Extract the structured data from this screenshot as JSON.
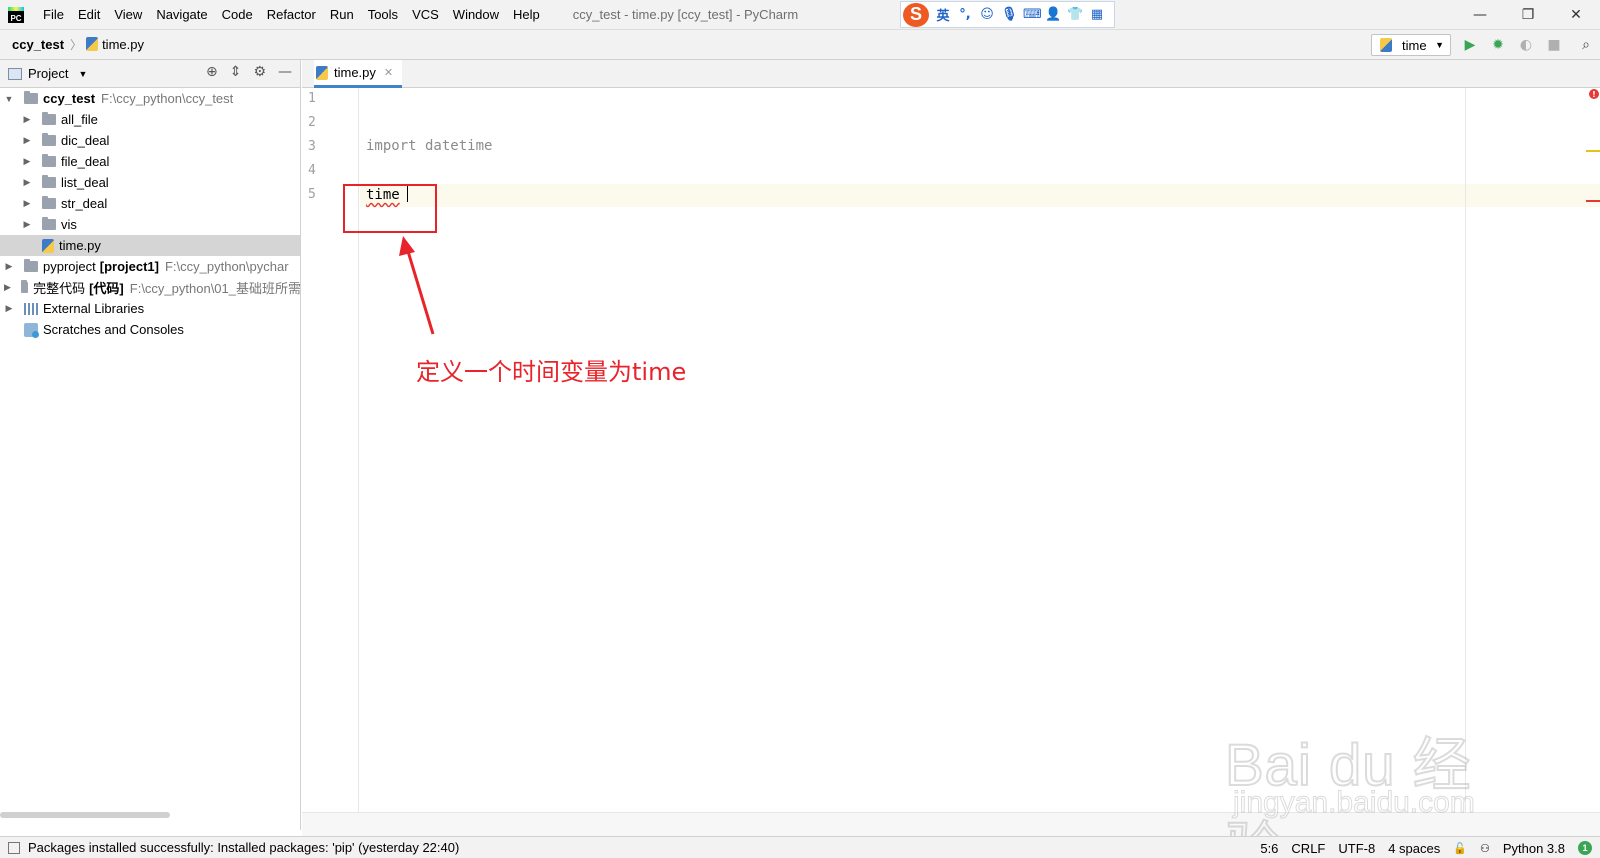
{
  "app": {
    "window_title": "ccy_test - time.py [ccy_test] - PyCharm",
    "logo_text": "PC"
  },
  "menu": [
    "File",
    "Edit",
    "View",
    "Navigate",
    "Code",
    "Refactor",
    "Run",
    "Tools",
    "VCS",
    "Window",
    "Help"
  ],
  "ime": {
    "logo": "S",
    "mode": "英",
    "icons": [
      "punctuation-icon",
      "emoji-icon",
      "mic-icon",
      "keyboard-icon",
      "user-icon",
      "skin-icon",
      "grid-icon"
    ]
  },
  "breadcrumb": {
    "root": "ccy_test",
    "file": "time.py"
  },
  "run_config": {
    "label": "time"
  },
  "project_panel": {
    "title": "Project",
    "tree": [
      {
        "label": "ccy_test",
        "path": "F:\\ccy_python\\ccy_test",
        "type": "folder",
        "expanded": true
      },
      {
        "label": "all_file",
        "type": "folder"
      },
      {
        "label": "dic_deal",
        "type": "folder"
      },
      {
        "label": "file_deal",
        "type": "folder"
      },
      {
        "label": "list_deal",
        "type": "folder"
      },
      {
        "label": "str_deal",
        "type": "folder"
      },
      {
        "label": "vis",
        "type": "folder"
      },
      {
        "label": "time.py",
        "type": "python-file",
        "selected": true
      },
      {
        "label": "pyproject",
        "label_suffix": "[project1]",
        "path": "F:\\ccy_python\\pychar",
        "type": "folder"
      },
      {
        "label": "完整代码",
        "label_suffix": "[代码]",
        "path": "F:\\ccy_python\\01_基础班所需",
        "type": "folder"
      },
      {
        "label": "External Libraries",
        "type": "library"
      },
      {
        "label": "Scratches and Consoles",
        "type": "scratch"
      }
    ]
  },
  "editor": {
    "tab_label": "time.py",
    "line_numbers": [
      "1",
      "2",
      "3",
      "4",
      "5"
    ],
    "lines": [
      "",
      "",
      "import datetime",
      "",
      "time"
    ]
  },
  "annotation": {
    "text": "定义一个时间变量为time",
    "color": "#e8232a"
  },
  "watermark": {
    "big": "Bai du 经验",
    "small": "jingyan.baidu.com"
  },
  "status": {
    "message": "Packages installed successfully: Installed packages: 'pip' (yesterday 22:40)",
    "position": "5:6",
    "line_sep": "CRLF",
    "encoding": "UTF-8",
    "indent": "4 spaces",
    "interpreter": "Python 3.8",
    "notifications": "1"
  }
}
